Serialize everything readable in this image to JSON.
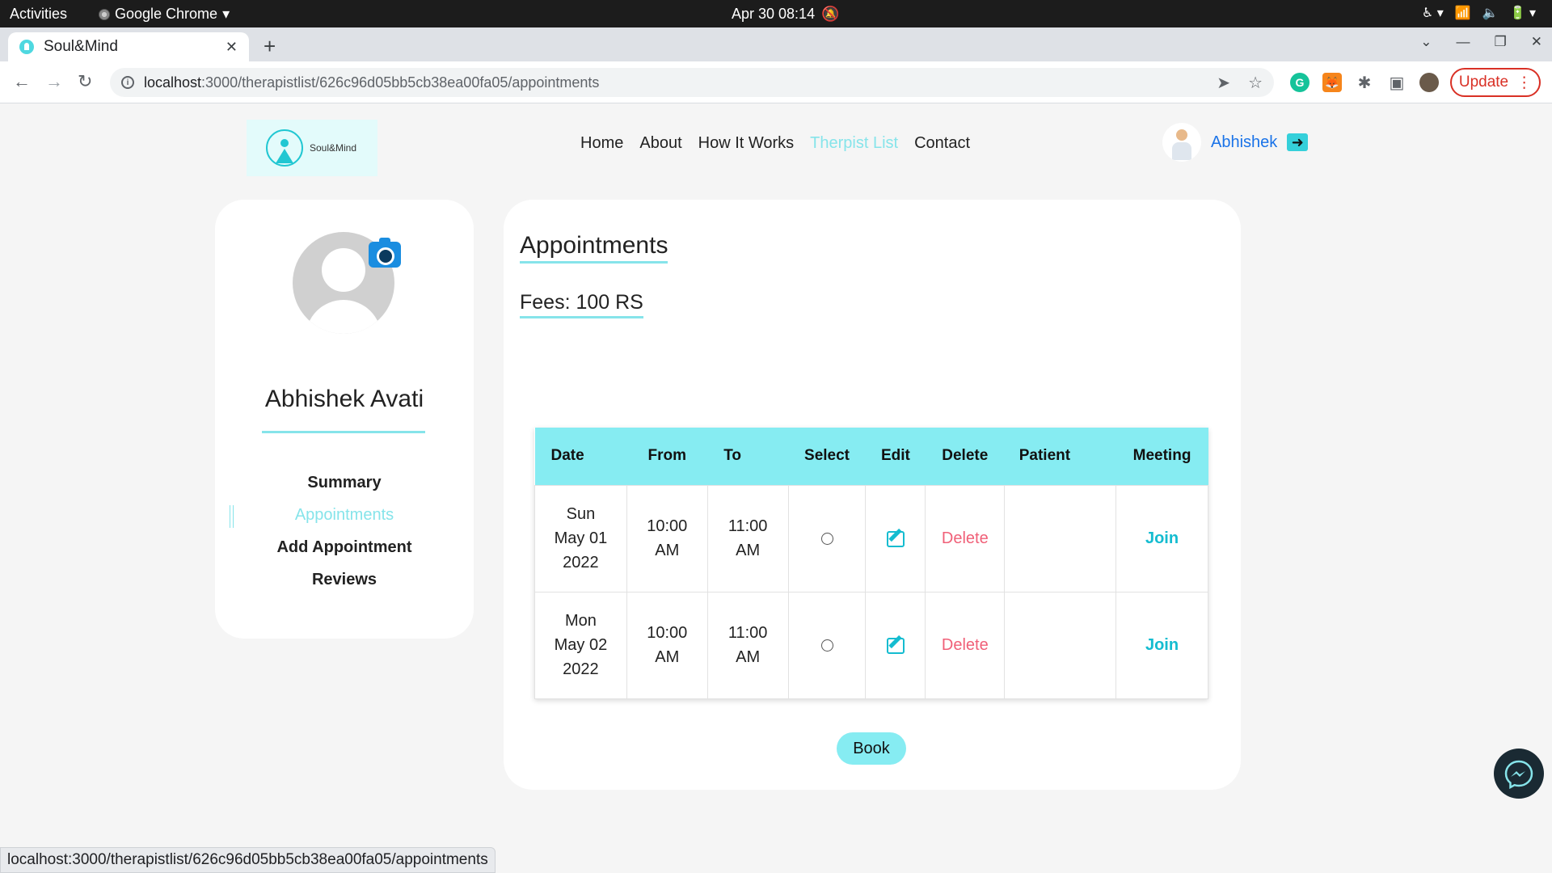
{
  "os": {
    "activities": "Activities",
    "app_menu": "Google Chrome",
    "clock": "Apr 30  08:14"
  },
  "browser": {
    "tab_title": "Soul&Mind",
    "url_host": "localhost",
    "url_path": ":3000/therapistlist/626c96d05bb5cb38ea00fa05/appointments",
    "update_label": "Update",
    "status_url": "localhost:3000/therapistlist/626c96d05bb5cb38ea00fa05/appointments"
  },
  "site": {
    "logo_text": "Soul&Mind",
    "nav": [
      {
        "label": "Home",
        "active": false
      },
      {
        "label": "About",
        "active": false
      },
      {
        "label": "How It Works",
        "active": false
      },
      {
        "label": "Therpist List",
        "active": true
      },
      {
        "label": "Contact",
        "active": false
      }
    ],
    "username": "Abhishek"
  },
  "profile": {
    "name": "Abhishek Avati",
    "menu": [
      {
        "label": "Summary",
        "active": false
      },
      {
        "label": "Appointments",
        "active": true
      },
      {
        "label": "Add Appointment",
        "active": false
      },
      {
        "label": "Reviews",
        "active": false
      }
    ]
  },
  "appointments": {
    "title": "Appointments",
    "fees": "Fees: 100 RS",
    "columns": [
      "Date",
      "From",
      "To",
      "Select",
      "Edit",
      "Delete",
      "Patient",
      "Meeting"
    ],
    "rows": [
      {
        "day": "Sun",
        "date": "May 01",
        "year": "2022",
        "from_time": "10:00",
        "from_ampm": "AM",
        "to_time": "11:00",
        "to_ampm": "AM",
        "delete": "Delete",
        "patient": "",
        "meeting": "Join"
      },
      {
        "day": "Mon",
        "date": "May 02",
        "year": "2022",
        "from_time": "10:00",
        "from_ampm": "AM",
        "to_time": "11:00",
        "to_ampm": "AM",
        "delete": "Delete",
        "patient": "",
        "meeting": "Join"
      }
    ],
    "book_label": "Book"
  },
  "colors": {
    "accent": "#86e4ea",
    "table_header": "#86ecf2",
    "delete": "#f06078",
    "join": "#14bcd0",
    "link_blue": "#1a73e8"
  },
  "icons": [
    "camera-icon",
    "edit-icon",
    "logout-icon",
    "messenger-icon",
    "info-icon",
    "star-icon"
  ]
}
